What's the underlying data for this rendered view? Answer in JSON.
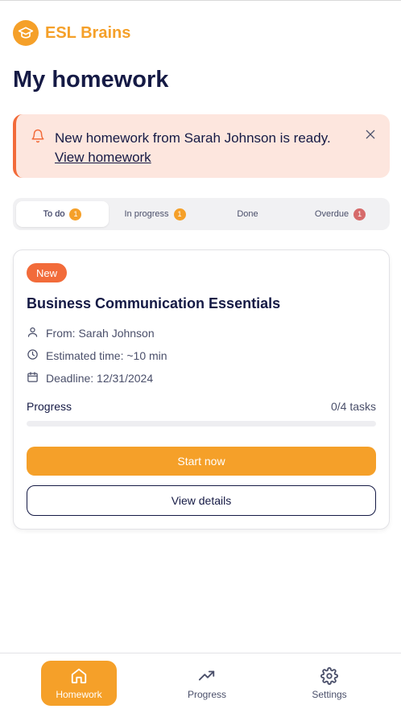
{
  "app": {
    "name": "ESL Brains"
  },
  "page": {
    "title": "My homework"
  },
  "notification": {
    "message": "New homework from Sarah Johnson is ready.",
    "link": "View homework"
  },
  "tabs": [
    {
      "label": "To do",
      "count": "1",
      "badge_color": "#f5a029"
    },
    {
      "label": "In progress",
      "count": "1",
      "badge_color": "#f5a029"
    },
    {
      "label": "Done"
    },
    {
      "label": "Overdue",
      "count": "1",
      "badge_color": "#d66a6a"
    }
  ],
  "assignment": {
    "badge": "New",
    "title": "Business Communication Essentials",
    "from": "From: Sarah Johnson",
    "estimated": "Estimated time: ~10 min",
    "deadline": "Deadline: 12/31/2024",
    "progress_label": "Progress",
    "progress_count": "0/4 tasks",
    "progress_fraction": 0,
    "start_label": "Start now",
    "details_label": "View details"
  },
  "nav": [
    {
      "label": "Homework",
      "icon": "home-icon"
    },
    {
      "label": "Progress",
      "icon": "trending-up-icon"
    },
    {
      "label": "Settings",
      "icon": "gear-icon"
    }
  ],
  "colors": {
    "accent": "#f5a029",
    "alert": "#f26b3a",
    "text": "#151a45"
  }
}
